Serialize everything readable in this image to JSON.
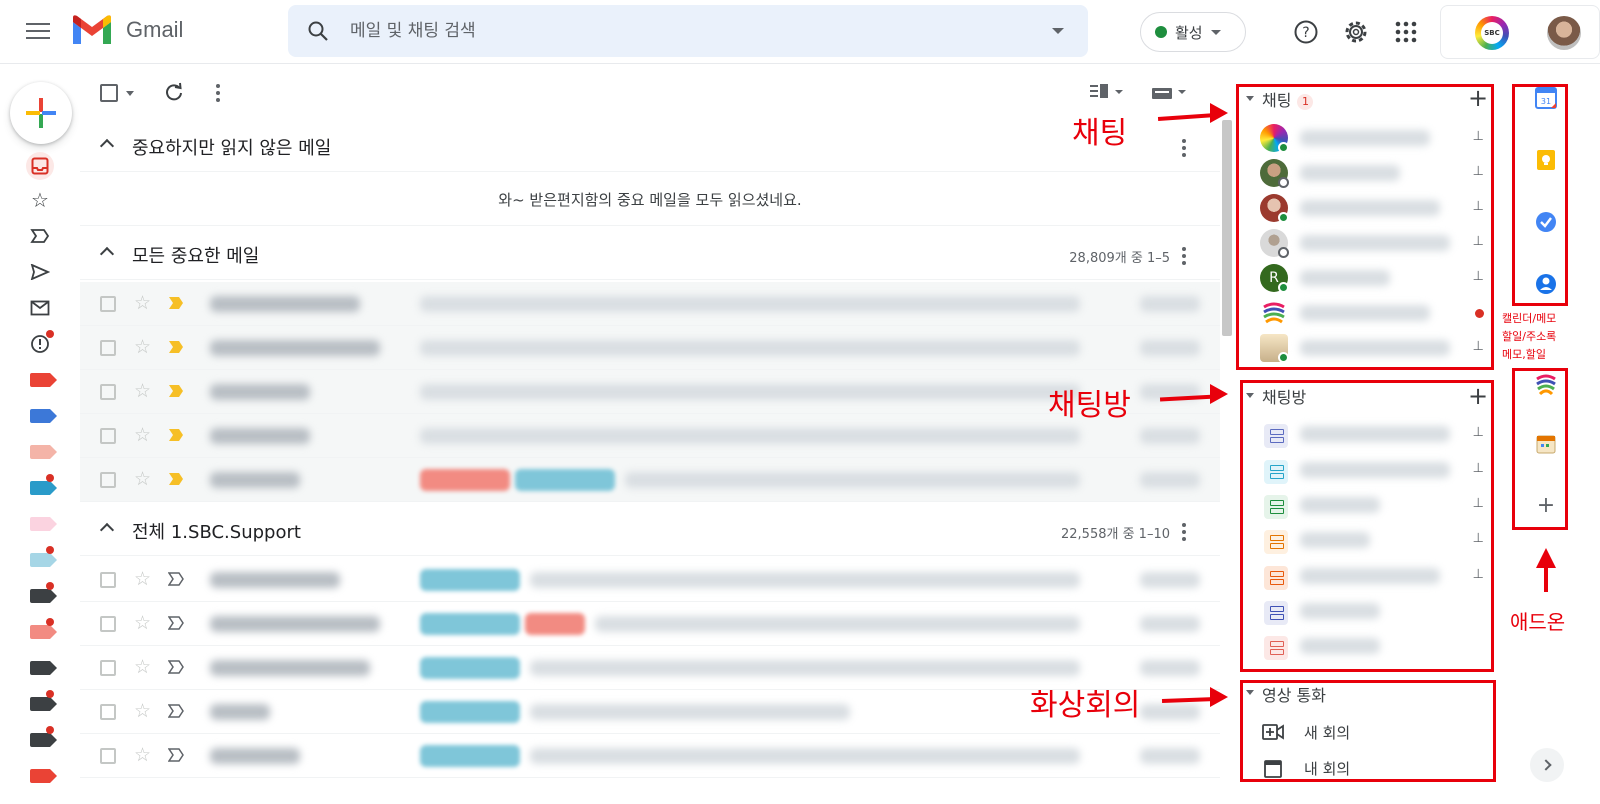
{
  "app": {
    "title": "Gmail"
  },
  "search": {
    "placeholder": "메일 및 채팅 검색"
  },
  "status": {
    "label": "활성",
    "color": "#1e8e3e"
  },
  "account": {
    "logo_text": "SBC"
  },
  "sections": [
    {
      "title": "중요하지만 읽지 않은 메일",
      "count": ""
    },
    {
      "title": "모든 중요한 메일",
      "count": "28,809개 중 1–5"
    },
    {
      "title": "전체 1.SBC.Support",
      "count": "22,558개 중 1–10"
    }
  ],
  "empty_message": "와~ 받은편지함의 중요 메일을 모두 읽으셨네요.",
  "chat": {
    "header": "채팅",
    "badge": "1"
  },
  "rooms": {
    "header": "채팅방"
  },
  "video": {
    "header": "영상 통화",
    "new_meeting": "새 회의",
    "my_meetings": "내 회의"
  },
  "annotations": {
    "chat": "채팅",
    "rooms": "채팅방",
    "meet": "화상회의",
    "addon": "애드온",
    "apps_note": [
      "캘린더/메모",
      "할일/주소록",
      "메모,할일"
    ]
  },
  "colors": {
    "annotation": "#e8000b",
    "accent_red": "#d93025",
    "online": "#1e8e3e"
  }
}
